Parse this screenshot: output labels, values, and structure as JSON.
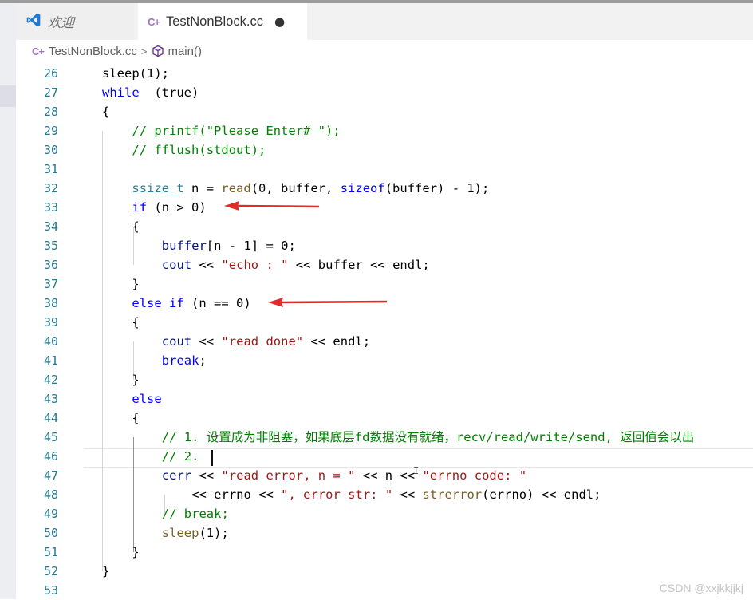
{
  "tabs": [
    {
      "label": "欢迎",
      "icon": "vscode-logo-icon",
      "active": false
    },
    {
      "label": "TestNonBlock.cc",
      "icon": "cpp-file-icon",
      "active": true,
      "dirty_marker": "●"
    }
  ],
  "breadcrumb": {
    "file": "TestNonBlock.cc",
    "separator": ">",
    "symbol": "main()",
    "file_icon_text": "C+"
  },
  "editor": {
    "line_numbers": [
      "26",
      "27",
      "28",
      "29",
      "30",
      "31",
      "32",
      "33",
      "34",
      "35",
      "36",
      "37",
      "38",
      "39",
      "40",
      "41",
      "42",
      "43",
      "44",
      "45",
      "46",
      "47",
      "48",
      "49",
      "50",
      "51",
      "52",
      "53"
    ],
    "lines": [
      [
        [
          "",
          "sleep"
        ],
        [
          "",
          "(1);"
        ]
      ],
      [
        [
          "kw",
          "while"
        ],
        [
          "",
          "  (true)"
        ]
      ],
      [
        [
          "",
          "{"
        ]
      ],
      [
        [
          "cm",
          "// printf(\"Please Enter# \");"
        ]
      ],
      [
        [
          "cm",
          "// fflush(stdout);"
        ]
      ],
      [],
      [
        [
          "ty",
          "ssize_t"
        ],
        [
          "",
          " n = "
        ],
        [
          "fn",
          "read"
        ],
        [
          "",
          ""
        ],
        [
          "",
          "(0, buffer, "
        ],
        [
          "kw",
          "sizeof"
        ],
        [
          "",
          "(buffer) - 1);"
        ]
      ],
      [
        [
          "kw",
          "if"
        ],
        [
          "",
          " (n > 0)"
        ]
      ],
      [
        [
          "",
          "{"
        ]
      ],
      [
        [
          "var",
          "buffer"
        ],
        [
          "",
          "[n - 1] = 0;"
        ]
      ],
      [
        [
          "var",
          "cout"
        ],
        [
          "",
          " << "
        ],
        [
          "str",
          "\"echo : \""
        ],
        [
          "",
          " << buffer << endl;"
        ]
      ],
      [
        [
          "",
          "}"
        ]
      ],
      [
        [
          "kw",
          "else if"
        ],
        [
          "",
          " (n == 0)"
        ]
      ],
      [
        [
          "",
          "{"
        ]
      ],
      [
        [
          "var",
          "cout"
        ],
        [
          "",
          " << "
        ],
        [
          "str",
          "\"read done\""
        ],
        [
          "",
          " << endl;"
        ]
      ],
      [
        [
          "kw",
          "break"
        ],
        [
          "",
          ";"
        ]
      ],
      [
        [
          "",
          "}"
        ]
      ],
      [
        [
          "kw",
          "else"
        ]
      ],
      [
        [
          "",
          "{"
        ]
      ],
      [
        [
          "cm",
          "// 1. 设置成为非阻塞，如果底层fd数据没有就绪，recv/read/write/send, 返回值会以出"
        ]
      ],
      [
        [
          "cm",
          "// 2. "
        ]
      ],
      [
        [
          "var",
          "cerr"
        ],
        [
          "",
          " << "
        ],
        [
          "str",
          "\"read error, n = \""
        ],
        [
          "",
          " << n << "
        ],
        [
          "str",
          "\"errno code: \""
        ]
      ],
      [
        [
          "",
          ""
        ],
        [
          "",
          "<< errno << "
        ],
        [
          "str",
          "\", error str: \""
        ],
        [
          "",
          " << "
        ],
        [
          "fn",
          "strerror"
        ],
        [
          "",
          "(errno) << endl;"
        ]
      ],
      [
        [
          "cm",
          "// break;"
        ]
      ],
      [
        [
          "fn",
          "sleep"
        ],
        [
          "",
          "(1);"
        ]
      ],
      [
        [
          "",
          "}"
        ]
      ],
      [
        [
          "",
          "}"
        ]
      ],
      []
    ]
  },
  "watermark": "CSDN @xxjkkjjkj"
}
